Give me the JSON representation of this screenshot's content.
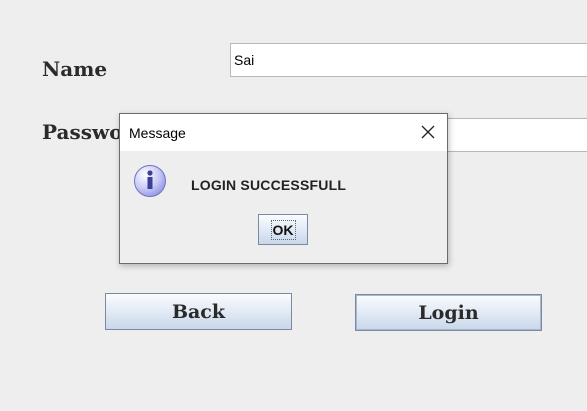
{
  "form": {
    "name_label": "Name",
    "name_value": "Sai",
    "password_label": "Password",
    "password_value": "",
    "back_label": "Back",
    "login_label": "Login"
  },
  "dialog": {
    "title": "Message",
    "message": "LOGIN SUCCESSFULL",
    "ok_label": "OK",
    "icon": "info-icon",
    "close_icon": "close-icon"
  },
  "colors": {
    "background": "#eeeeee",
    "button_gradient_top": "#fbfcfe",
    "button_gradient_bottom": "#c9d7ea",
    "info_icon": "#8a8ee0"
  }
}
